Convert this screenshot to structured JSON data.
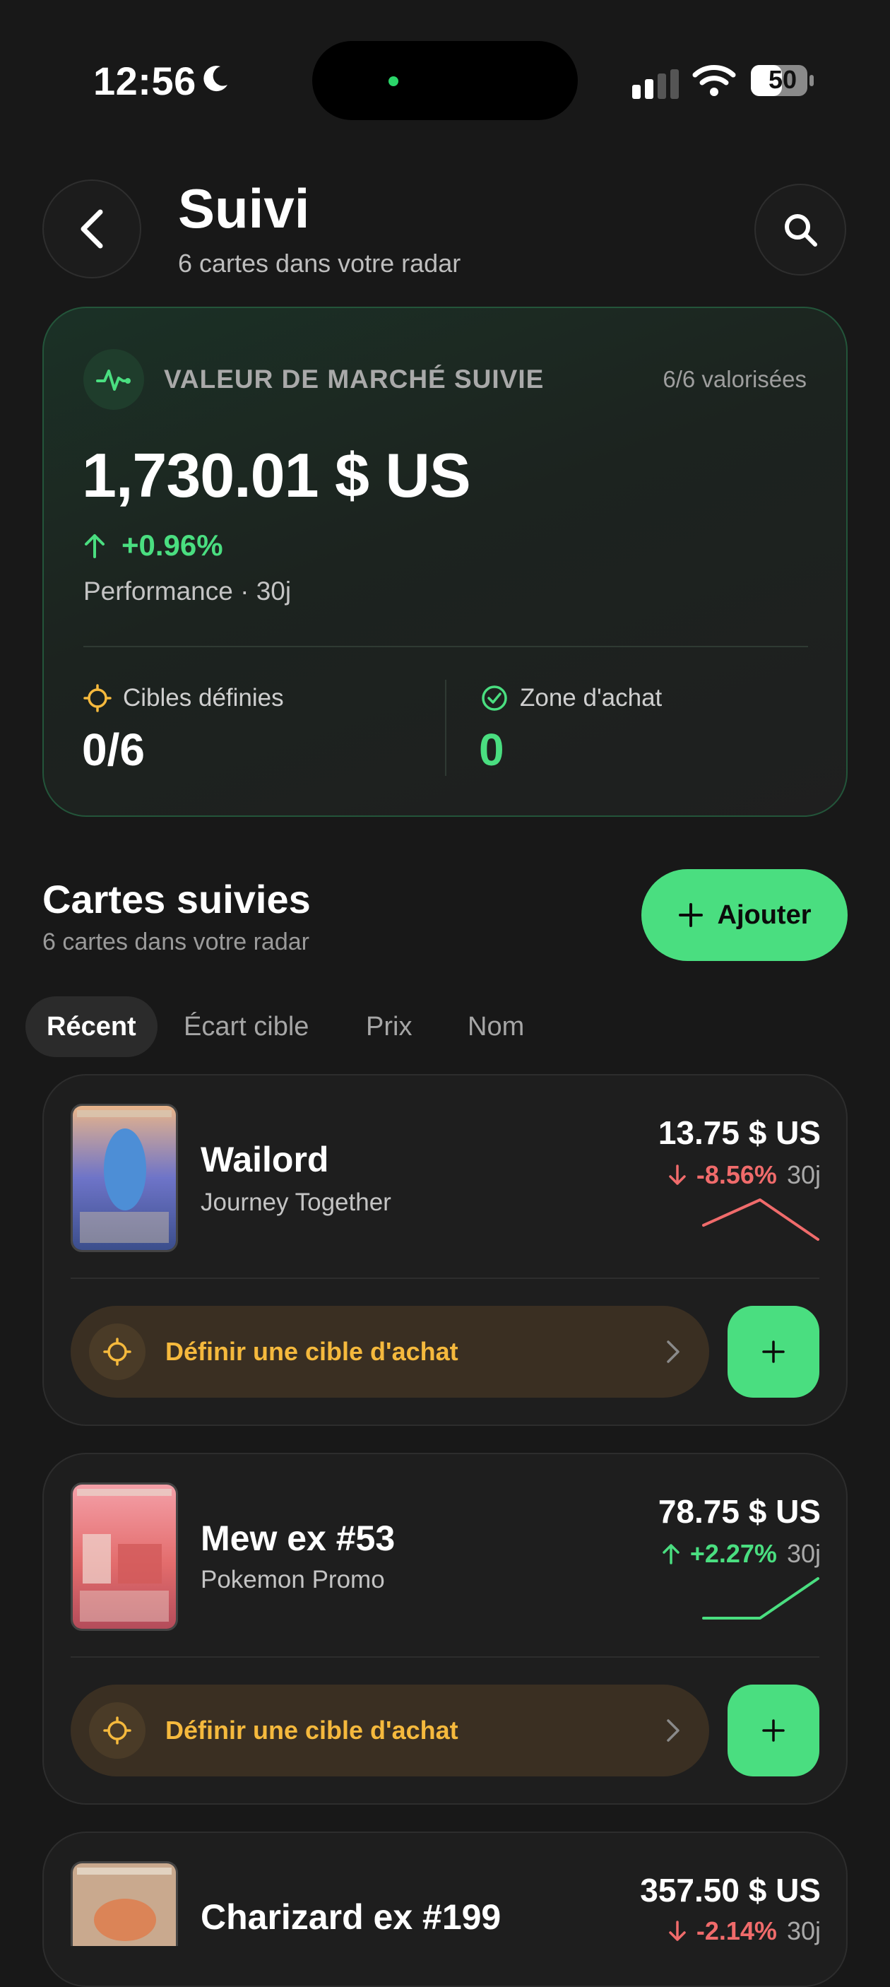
{
  "status_bar": {
    "time": "12:56",
    "battery": "50"
  },
  "header": {
    "title": "Suivi",
    "subtitle": "6 cartes dans votre radar"
  },
  "market": {
    "label": "VALEUR DE MARCHÉ SUIVIE",
    "valued": "6/6 valorisées",
    "value": "1,730.01 $ US",
    "change": "+0.96%",
    "performance_label": "Performance · 30j",
    "targets_label": "Cibles définies",
    "targets_value": "0/6",
    "zone_label": "Zone d'achat",
    "zone_value": "0"
  },
  "section": {
    "title": "Cartes suivies",
    "subtitle": "6 cartes dans votre radar",
    "add_label": "Ajouter"
  },
  "tabs": [
    "Récent",
    "Écart cible",
    "Prix",
    "Nom"
  ],
  "cards": [
    {
      "name": "Wailord",
      "set": "Journey Together",
      "price": "13.75 $ US",
      "change": "-8.56%",
      "period": "30j",
      "direction": "down",
      "target_label": "Définir une cible d'achat"
    },
    {
      "name": "Mew ex #53",
      "set": "Pokemon Promo",
      "price": "78.75 $ US",
      "change": "+2.27%",
      "period": "30j",
      "direction": "up",
      "target_label": "Définir une cible d'achat"
    },
    {
      "name": "Charizard ex #199",
      "price": "357.50 $ US",
      "change": "-2.14%",
      "period": "30j",
      "direction": "down"
    }
  ],
  "colors": {
    "accent_green": "#4ade80",
    "down_red": "#f06b6b",
    "target_orange": "#f5b93d",
    "background": "#181818"
  }
}
